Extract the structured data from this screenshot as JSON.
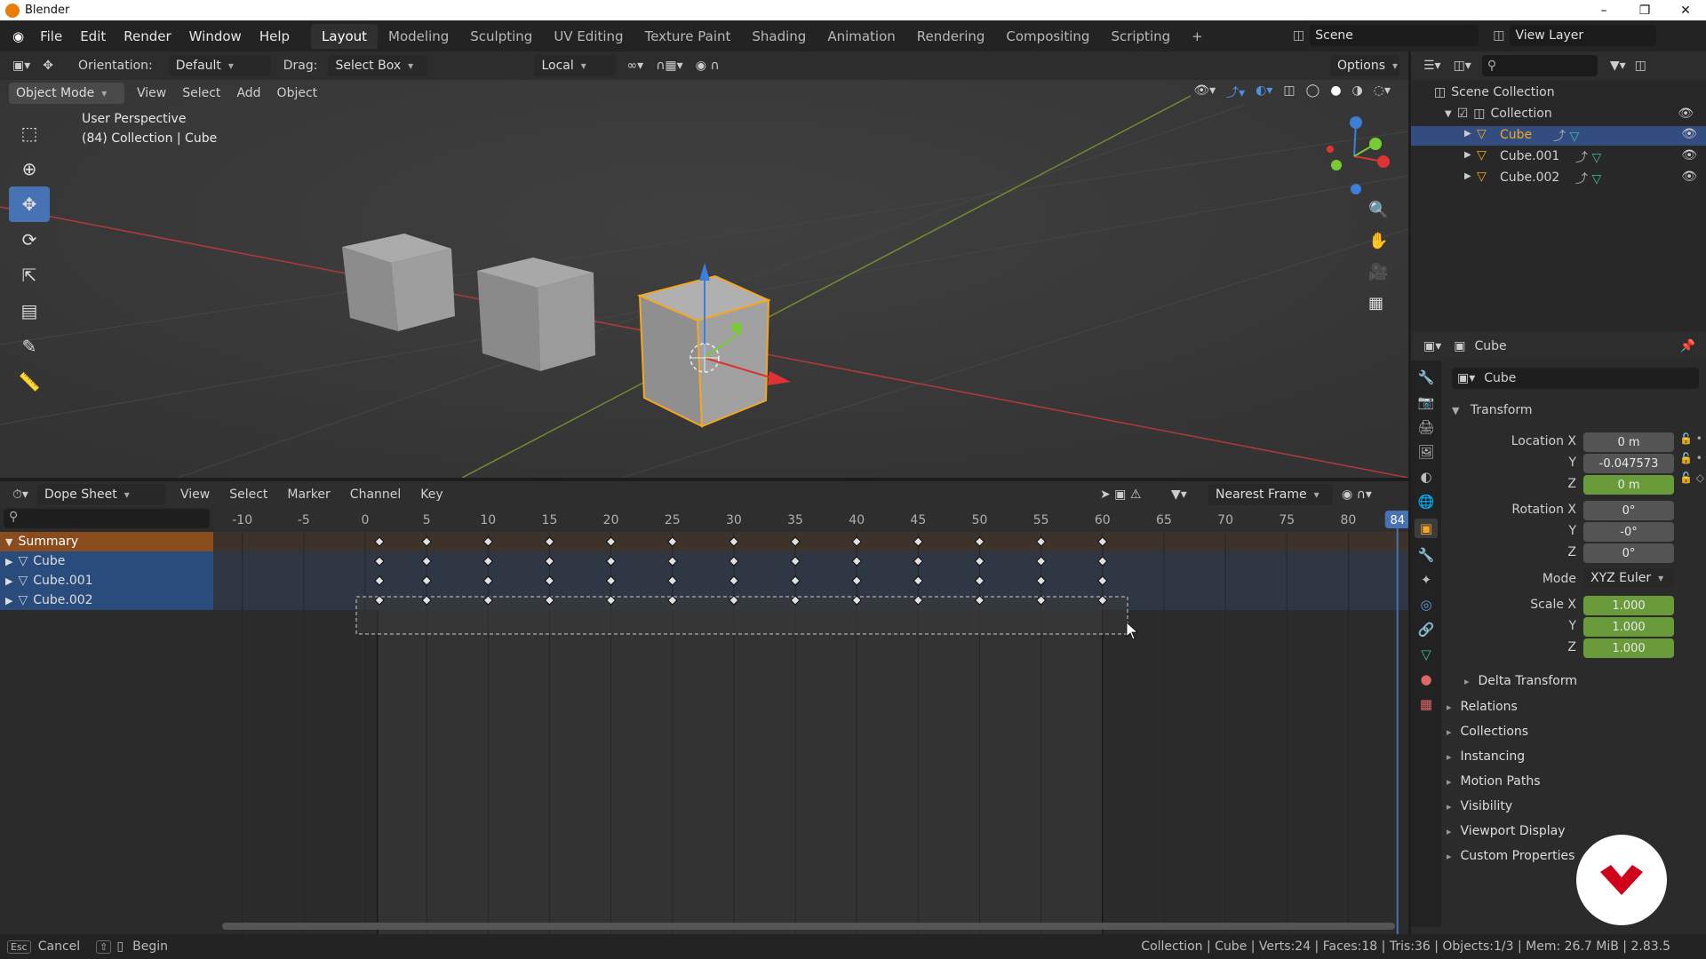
{
  "app": {
    "title": "Blender"
  },
  "menu": [
    "File",
    "Edit",
    "Render",
    "Window",
    "Help"
  ],
  "workspaces": [
    "Layout",
    "Modeling",
    "Sculpting",
    "UV Editing",
    "Texture Paint",
    "Shading",
    "Animation",
    "Rendering",
    "Compositing",
    "Scripting",
    "+"
  ],
  "scene": {
    "label": "Scene",
    "view_layer": "View Layer"
  },
  "tool_header": {
    "orientation_label": "Orientation:",
    "orientation_value": "Default",
    "drag_label": "Drag:",
    "drag_value": "Select Box",
    "pivot_value": "Local",
    "options_label": "Options"
  },
  "viewport": {
    "mode": "Object Mode",
    "menus": [
      "View",
      "Select",
      "Add",
      "Object"
    ],
    "overlay_line1": "User Perspective",
    "overlay_line2": "(84) Collection | Cube"
  },
  "dopesheet": {
    "editor": "Dope Sheet",
    "menus": [
      "View",
      "Select",
      "Marker",
      "Channel",
      "Key"
    ],
    "snap": "Nearest Frame",
    "current_frame": "84",
    "ruler": [
      "-10",
      "-5",
      "0",
      "5",
      "10",
      "15",
      "20",
      "25",
      "30",
      "35",
      "40",
      "45",
      "50",
      "55",
      "60",
      "65",
      "70",
      "75",
      "80"
    ],
    "keyframes": [
      0,
      5,
      10,
      15,
      20,
      25,
      30,
      35,
      40,
      45,
      50,
      55,
      60
    ],
    "channels": [
      {
        "name": "Summary"
      },
      {
        "name": "Cube"
      },
      {
        "name": "Cube.001"
      },
      {
        "name": "Cube.002"
      }
    ]
  },
  "outliner": {
    "root": "Scene Collection",
    "collection": "Collection",
    "items": [
      "Cube",
      "Cube.001",
      "Cube.002"
    ]
  },
  "properties": {
    "header": "Cube",
    "object_name": "Cube",
    "transform_label": "Transform",
    "location": {
      "label_x": "Location X",
      "label_y": "Y",
      "label_z": "Z",
      "x": "0 m",
      "y": "-0.047573",
      "z": "0 m"
    },
    "rotation": {
      "label_x": "Rotation X",
      "label_y": "Y",
      "label_z": "Z",
      "x": "0°",
      "y": "-0°",
      "z": "0°"
    },
    "mode": {
      "label": "Mode",
      "value": "XYZ Euler"
    },
    "scale": {
      "label_x": "Scale X",
      "label_y": "Y",
      "label_z": "Z",
      "x": "1.000",
      "y": "1.000",
      "z": "1.000"
    },
    "panels": [
      "Delta Transform",
      "Relations",
      "Collections",
      "Instancing",
      "Motion Paths",
      "Visibility",
      "Viewport Display",
      "Custom Properties"
    ]
  },
  "statusbar": {
    "cancel": "Cancel",
    "begin": "Begin",
    "info": "Collection | Cube | Verts:24 | Faces:18 | Tris:36 | Objects:1/3 | Mem: 26.7 MiB | 2.83.5"
  },
  "colors": {
    "accent": "#4772b3",
    "selected_orange": "#f5a623",
    "keyed_green": "#6a9b3a",
    "brand_red": "#d0021b"
  }
}
